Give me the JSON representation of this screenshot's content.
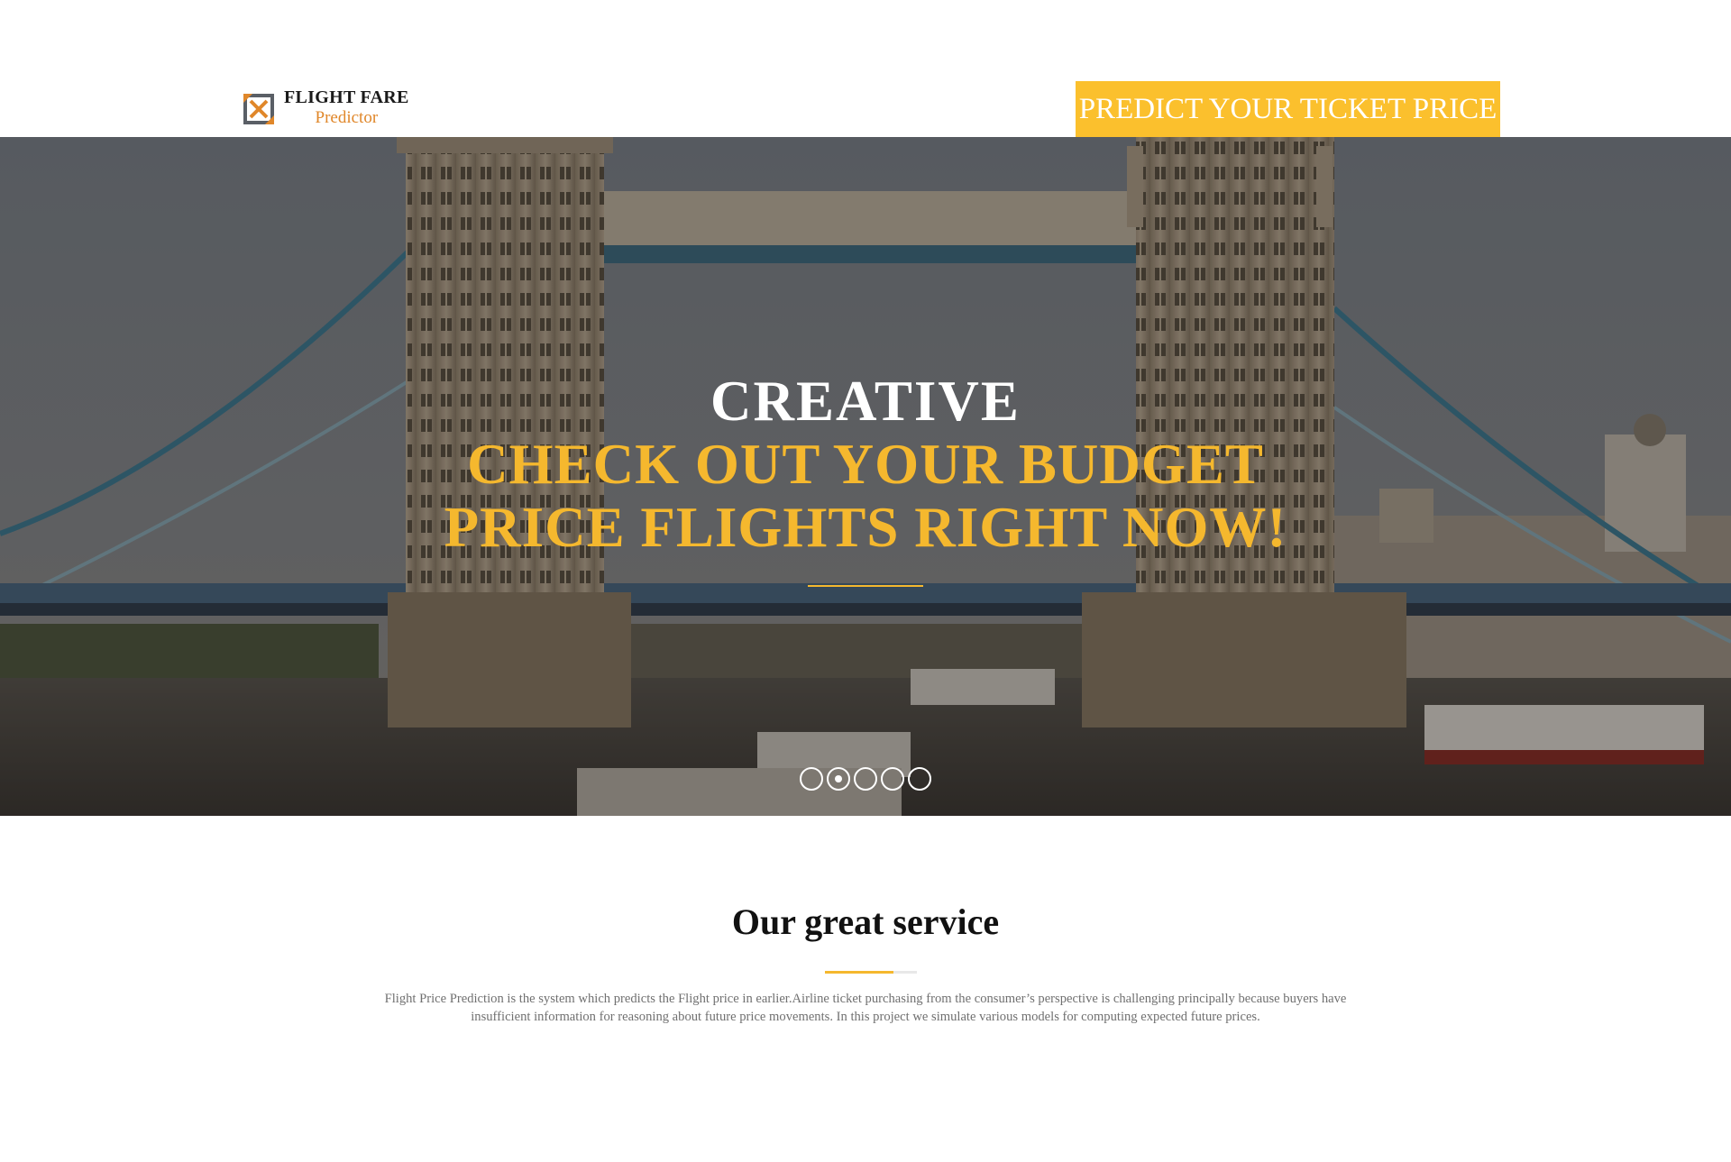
{
  "brand": {
    "title": "FLIGHT FARE",
    "subtitle": "Predictor",
    "logo_icon": "diamond-arrows-logo-icon",
    "accent_color": "#f5b82e",
    "logo_orange": "#e0872a"
  },
  "header": {
    "cta_label": "PREDICT YOUR TICKET PRICE",
    "cta_color": "#fbc02d"
  },
  "hero": {
    "kicker": "CREATIVE",
    "headline_line1": "CHECK OUT YOUR BUDGET",
    "headline_line2": "PRICE FLIGHTS RIGHT NOW!",
    "slide_count": 5,
    "active_slide": 2
  },
  "service": {
    "title": "Our great service",
    "description": "Flight Price Prediction is the system which predicts the Flight price in earlier.Airline ticket purchasing from the consumer’s perspective is challenging principally because buyers have insufficient information for reasoning about future price movements. In this project we simulate various models for computing expected future prices."
  }
}
